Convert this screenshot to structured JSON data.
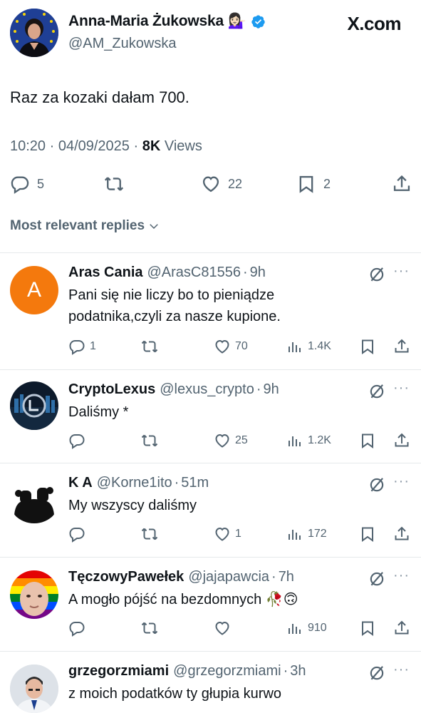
{
  "site": "X.com",
  "tweet": {
    "author_name": "Anna-Maria Żukowska",
    "author_emoji": "💁🏻‍♀️",
    "author_handle": "@AM_Zukowska",
    "text": "Raz za kozaki dałam 700.",
    "time": "10:20 · 04/09/2025 · ",
    "views_count": "8K",
    "views_label": " Views",
    "replies": "5",
    "reposts": "",
    "likes": "22",
    "bookmarks": "2",
    "icons": [
      "reply-icon",
      "repost-icon",
      "like-icon",
      "bookmark-icon",
      "share-icon",
      "verified-badge-icon"
    ]
  },
  "sort_label": "Most relevant replies",
  "colors": {
    "verified": "#1d9bf0",
    "secondary_text": "#536471",
    "text": "#0f1419",
    "divider": "#e6e9eb",
    "avatar_orange": "#f4790d"
  },
  "replies": [
    {
      "name": "Aras Cania",
      "handle": "@ArasC81556",
      "time": "9h",
      "avatar_letter": "A",
      "text": "Pani się nie liczy bo to pieniądze podatnika,czyli za nasze kupione.",
      "reply_count": "1",
      "likes": "70",
      "views": "1.4K"
    },
    {
      "name": "CryptoLexus",
      "handle": "@lexus_crypto",
      "time": "9h",
      "text": "Daliśmy *",
      "reply_count": "",
      "likes": "25",
      "views": "1.2K"
    },
    {
      "name": "K A",
      "handle": "@Korne1ito",
      "time": "51m",
      "text": "My wszyscy daliśmy",
      "reply_count": "",
      "likes": "1",
      "views": "172"
    },
    {
      "name": "TęczowyPawełek",
      "handle": "@jajapawcia",
      "time": "7h",
      "text": "A mogło pójść na bezdomnych 🥀🙃",
      "reply_count": "",
      "likes": "",
      "views": "910"
    },
    {
      "name": "grzegorzmiami",
      "handle": "@grzegorzmiami",
      "time": "3h",
      "text": "z moich podatków ty głupia kurwo",
      "reply_count": "",
      "likes": "",
      "views": ""
    }
  ]
}
